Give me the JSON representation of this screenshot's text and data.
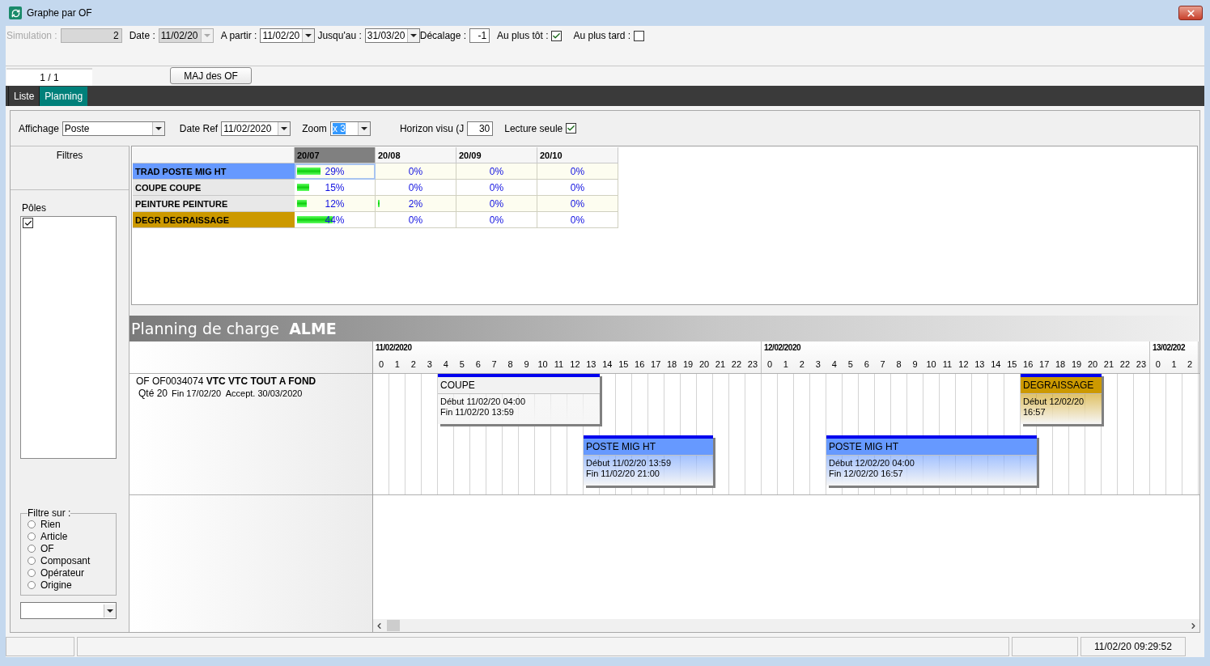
{
  "window": {
    "title": "Graphe par OF"
  },
  "toolbar": [
    {
      "kind": "number",
      "label": "Simulation :",
      "value": "2",
      "disabled": true
    },
    {
      "kind": "combo",
      "label": "Date :",
      "value": "11/02/20",
      "disabled": true
    },
    {
      "kind": "combo",
      "label": "A partir :",
      "value": "11/02/20",
      "disabled": false
    },
    {
      "kind": "combo",
      "label": "Jusqu'au :",
      "value": "31/03/20",
      "disabled": false
    },
    {
      "kind": "number",
      "label": "Décalage :",
      "value": "-1",
      "disabled": false
    },
    {
      "kind": "check",
      "label": "Au plus tôt :",
      "checked": true
    },
    {
      "kind": "check",
      "label": "Au plus tard :",
      "checked": false
    }
  ],
  "pager": {
    "label": "1 / 1"
  },
  "update_button": "MAJ des OF",
  "tabs": [
    {
      "label": "Liste",
      "selected": false
    },
    {
      "label": "Planning",
      "selected": true
    }
  ],
  "options": [
    {
      "kind": "combo",
      "label": "Affichage",
      "value": "Poste",
      "text_selected": false
    },
    {
      "kind": "combo",
      "label": "Date Ref",
      "value": "11/02/2020",
      "text_selected": false
    },
    {
      "kind": "combo",
      "label": "Zoom",
      "value": "x 3",
      "text_selected": true
    },
    {
      "kind": "number",
      "label": "Horizon visu (J",
      "value": "30"
    },
    {
      "kind": "check",
      "label": "Lecture seule",
      "checked": true
    }
  ],
  "filters": {
    "title": "Filtres",
    "poles_label": "Pôles",
    "poles": [
      {
        "checked": true
      }
    ],
    "group_title": "Filtre sur :",
    "radios": [
      {
        "label": "Rien",
        "selected": false
      },
      {
        "label": "Article",
        "selected": false
      },
      {
        "label": "OF",
        "selected": false
      },
      {
        "label": "Composant",
        "selected": false
      },
      {
        "label": "Opérateur",
        "selected": false
      },
      {
        "label": "Origine",
        "selected": false
      }
    ]
  },
  "load_table": {
    "columns": [
      {
        "label": "20/07",
        "selected": true
      },
      {
        "label": "20/08",
        "selected": false
      },
      {
        "label": "20/09",
        "selected": false
      },
      {
        "label": "20/10",
        "selected": false
      }
    ],
    "rows": [
      {
        "label": "TRAD POSTE MIG HT",
        "color": "#6699ff",
        "cells": [
          {
            "value": "29%",
            "level": 0.29,
            "selected": true
          },
          {
            "value": "0%",
            "selected": false
          },
          {
            "value": "0%",
            "selected": false
          },
          {
            "value": "0%",
            "selected": false
          }
        ]
      },
      {
        "label": "COUPE COUPE",
        "color": "#e8e8e8",
        "cells": [
          {
            "value": "15%",
            "level": 0.15,
            "selected": false
          },
          {
            "value": "0%",
            "selected": false
          },
          {
            "value": "0%",
            "selected": false
          },
          {
            "value": "0%",
            "selected": false
          }
        ]
      },
      {
        "label": "PEINTURE PEINTURE",
        "color": "#e8e8e8",
        "cells": [
          {
            "value": "12%",
            "level": 0.12,
            "selected": false
          },
          {
            "value": "2%",
            "level": 0.02,
            "selected": false
          },
          {
            "value": "0%",
            "selected": false
          },
          {
            "value": "0%",
            "selected": false
          }
        ]
      },
      {
        "label": "DEGR DEGRAISSAGE",
        "color": "#cc9900",
        "cells": [
          {
            "value": "44%",
            "level": 0.44,
            "selected": false
          },
          {
            "value": "0%",
            "selected": false
          },
          {
            "value": "0%",
            "selected": false
          },
          {
            "value": "0%",
            "selected": false
          }
        ]
      }
    ]
  },
  "planning": {
    "title": "Planning de charge  **ALME**",
    "days": [
      {
        "date": "11/02/2020",
        "hours": [
          "0",
          "1",
          "2",
          "3",
          "4",
          "5",
          "6",
          "7",
          "8",
          "9",
          "10",
          "11",
          "12",
          "13",
          "14",
          "15",
          "16",
          "17",
          "18",
          "19",
          "20",
          "21",
          "22",
          "23"
        ]
      },
      {
        "date": "12/02/2020",
        "hours": [
          "0",
          "1",
          "2",
          "3",
          "4",
          "5",
          "6",
          "7",
          "8",
          "9",
          "10",
          "11",
          "12",
          "13",
          "14",
          "15",
          "16",
          "17",
          "18",
          "19",
          "20",
          "21",
          "22",
          "23"
        ]
      },
      {
        "date": "13/02/202",
        "hours": [
          "0",
          "1",
          "2"
        ]
      }
    ],
    "orders": [
      {
        "line1": "OF OF0034074 **VTC VTC TOUT A FOND**",
        "quantity": "Qté 20",
        "details": "Fin 17/02/20  Accept. 30/03/2020",
        "tasks": [
          {
            "title": "COUPE",
            "color": "#f2f2f2",
            "start": "Début 11/02/20 04:00",
            "end": "Fin 11/02/20 13:59"
          },
          {
            "title": "POSTE MIG HT",
            "color": "#6699ff",
            "start": "Début 11/02/20 13:59",
            "end": "Fin 11/02/20 21:00"
          },
          {
            "title": "POSTE MIG HT",
            "color": "#6699ff",
            "start": "Début 12/02/20 04:00",
            "end": "Fin 12/02/20 16:57"
          },
          {
            "title": "DEGRAISSAGE",
            "color": "#cc9900",
            "start": "Début 12/02/20 16:57"
          }
        ]
      }
    ]
  },
  "status_bar": {
    "clock": "11/02/20 09:29:52"
  }
}
